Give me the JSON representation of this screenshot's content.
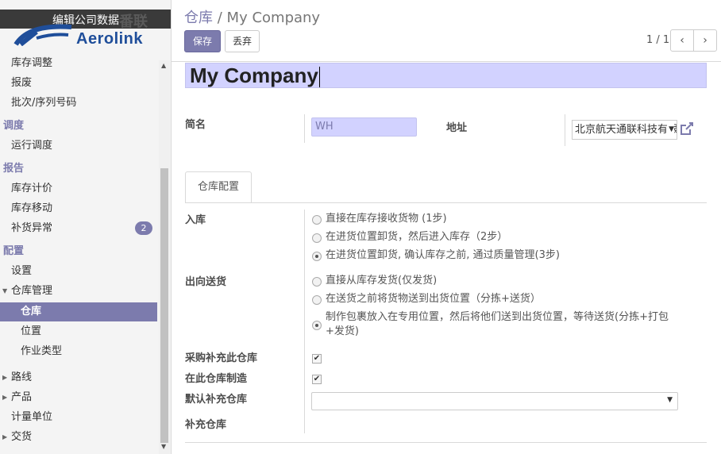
{
  "logo": {
    "banner_text": "编辑公司数据",
    "watermark": "番联",
    "brand": "Aerolink"
  },
  "sidebar": {
    "items": [
      {
        "label": "库存调整"
      },
      {
        "label": "报废"
      },
      {
        "label": "批次/序列号码"
      },
      {
        "label": "调度"
      },
      {
        "label": "运行调度"
      },
      {
        "label": "报告"
      },
      {
        "label": "库存计价"
      },
      {
        "label": "库存移动"
      },
      {
        "label": "补货异常",
        "badge": "2"
      },
      {
        "label": "配置"
      },
      {
        "label": "设置"
      },
      {
        "label": "仓库管理"
      },
      {
        "label": "仓库"
      },
      {
        "label": "位置"
      },
      {
        "label": "作业类型"
      },
      {
        "label": "路线"
      },
      {
        "label": "产品"
      },
      {
        "label": "计量单位"
      },
      {
        "label": "交货"
      }
    ]
  },
  "breadcrumb": {
    "parent": "仓库",
    "separator": "/",
    "current": "My Company"
  },
  "toolbar": {
    "save_label": "保存",
    "discard_label": "丢弃"
  },
  "pager": {
    "text": "1 / 1",
    "prev": "‹",
    "next": "›"
  },
  "form": {
    "name": "My Company",
    "code_label": "简名",
    "code_value": "WH",
    "address_label": "地址",
    "address_value": "北京航天通联科技有限公司",
    "tab_label": "仓库配置",
    "incoming_label": "入库",
    "incoming_options": [
      {
        "label": "直接在库存接收货物 (1步)",
        "selected": false
      },
      {
        "label": "在进货位置卸货，然后进入库存（2步）",
        "selected": false
      },
      {
        "label": "在进货位置卸货, 确认库存之前, 通过质量管理(3步)",
        "selected": true
      }
    ],
    "outgoing_label": "出向送货",
    "outgoing_options": [
      {
        "label": "直接从库存发货(仅发货)",
        "selected": false
      },
      {
        "label": "在送货之前将货物送到出货位置（分拣+送货）",
        "selected": false
      },
      {
        "label": "制作包裹放入在专用位置，然后将他们送到出货位置，等待送货(分拣+打包",
        "label2": "+发货)",
        "selected": true
      }
    ],
    "buy_resupply_label": "采购补充此仓库",
    "buy_resupply_checked": true,
    "manufacture_label": "在此仓库制造",
    "manufacture_checked": true,
    "default_resupply_label": "默认补充仓库",
    "default_resupply_value": "",
    "resupply_from_label": "补充仓库"
  },
  "colors": {
    "accent": "#7c7bad",
    "input_bg": "#d2d2ff"
  }
}
